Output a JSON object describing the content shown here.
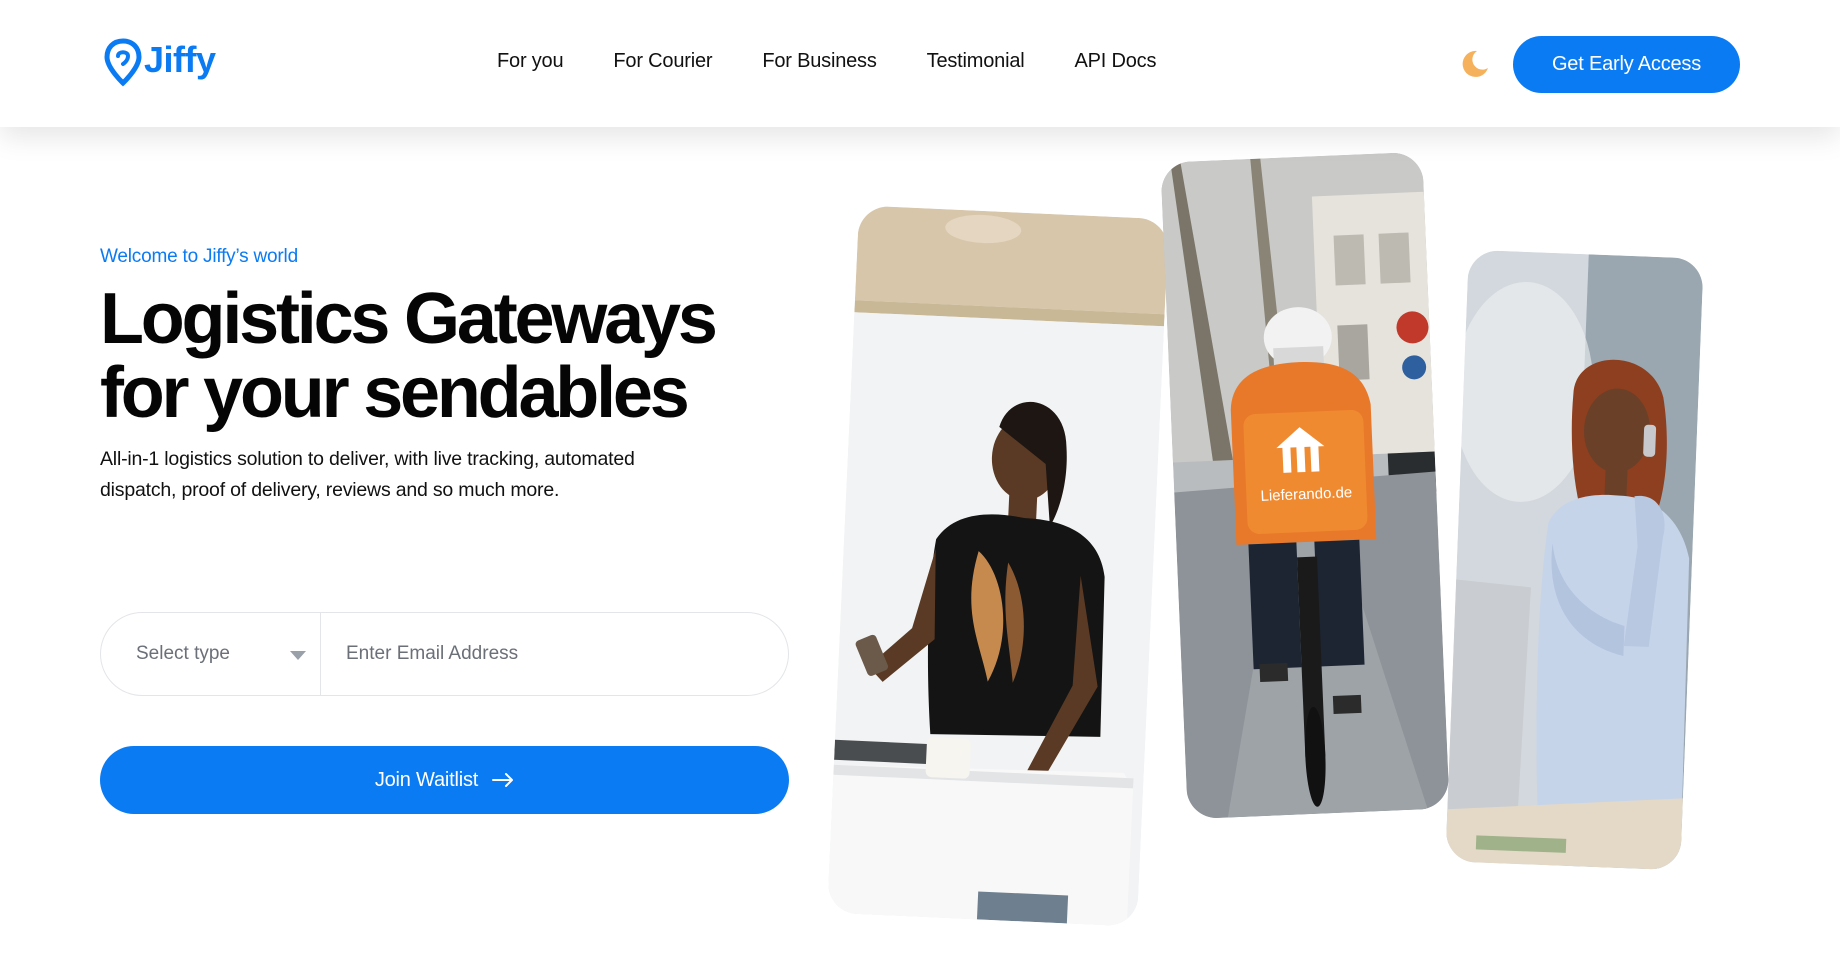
{
  "brand": {
    "name": "Jiffy",
    "color": "#0a7bf2"
  },
  "nav": {
    "items": [
      {
        "label": "For you"
      },
      {
        "label": "For Courier"
      },
      {
        "label": "For Business"
      },
      {
        "label": "Testimonial"
      },
      {
        "label": "API Docs"
      }
    ]
  },
  "header": {
    "theme_icon": "moon-icon",
    "cta_label": "Get Early Access"
  },
  "hero": {
    "eyebrow": "Welcome to Jiffy’s world",
    "headline_line1": "Logistics Gateways",
    "headline_line2": "for your sendables",
    "subtitle": "All-in-1 logistics solution to deliver, with live tracking, automated dispatch, proof of delivery, reviews and so much more."
  },
  "form": {
    "select_placeholder": "Select type",
    "email_placeholder": "Enter Email Address",
    "submit_label": "Join Waitlist",
    "submit_icon": "arrow-right-icon"
  },
  "images": {
    "card1": "man-with-phone-photo",
    "card2": "delivery-cyclist-photo",
    "card3": "woman-on-phone-photo",
    "bag_logo_text": "Lieferando.de"
  }
}
